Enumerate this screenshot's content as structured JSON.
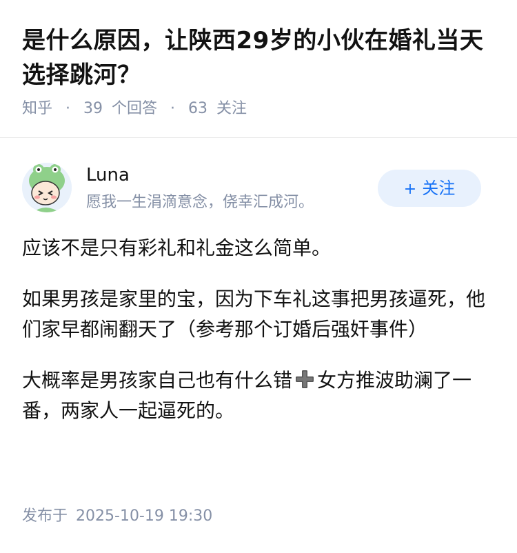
{
  "question": {
    "title": "是什么原因，让陕西29岁的小伙在婚礼当天选择跳河？",
    "source": "知乎",
    "separator": "·",
    "answer_count": "39",
    "answer_label": "个回答",
    "follower_count": "63",
    "follower_label": "关注"
  },
  "author": {
    "name": "Luna",
    "bio": "愿我一生涓滴意念，侥幸汇成河。",
    "avatar_icon": "cartoon-frog-hat-avatar",
    "follow_icon": "plus-icon",
    "follow_symbol": "+",
    "follow_label": "关注"
  },
  "answer": {
    "paragraph_1": "应该不是只有彩礼和礼金这么简单。",
    "paragraph_2": "如果男孩是家里的宝，因为下车礼这事把男孩逼死，他们家早都闹翻天了（参考那个订婚后强奸事件）",
    "paragraph_3_before": "大概率是男孩家自己也有什么错",
    "paragraph_3_emoji": "heavy-plus-emoji",
    "paragraph_3_after": "女方推波助澜了一番，两家人一起逼死的。",
    "publish_label": "发布于",
    "publish_date": "2025-10-19 19:30"
  },
  "colors": {
    "text": "#121212",
    "meta": "#8590a6",
    "brand_blue": "#1772f6",
    "follow_bg": "#e8f1fd"
  }
}
